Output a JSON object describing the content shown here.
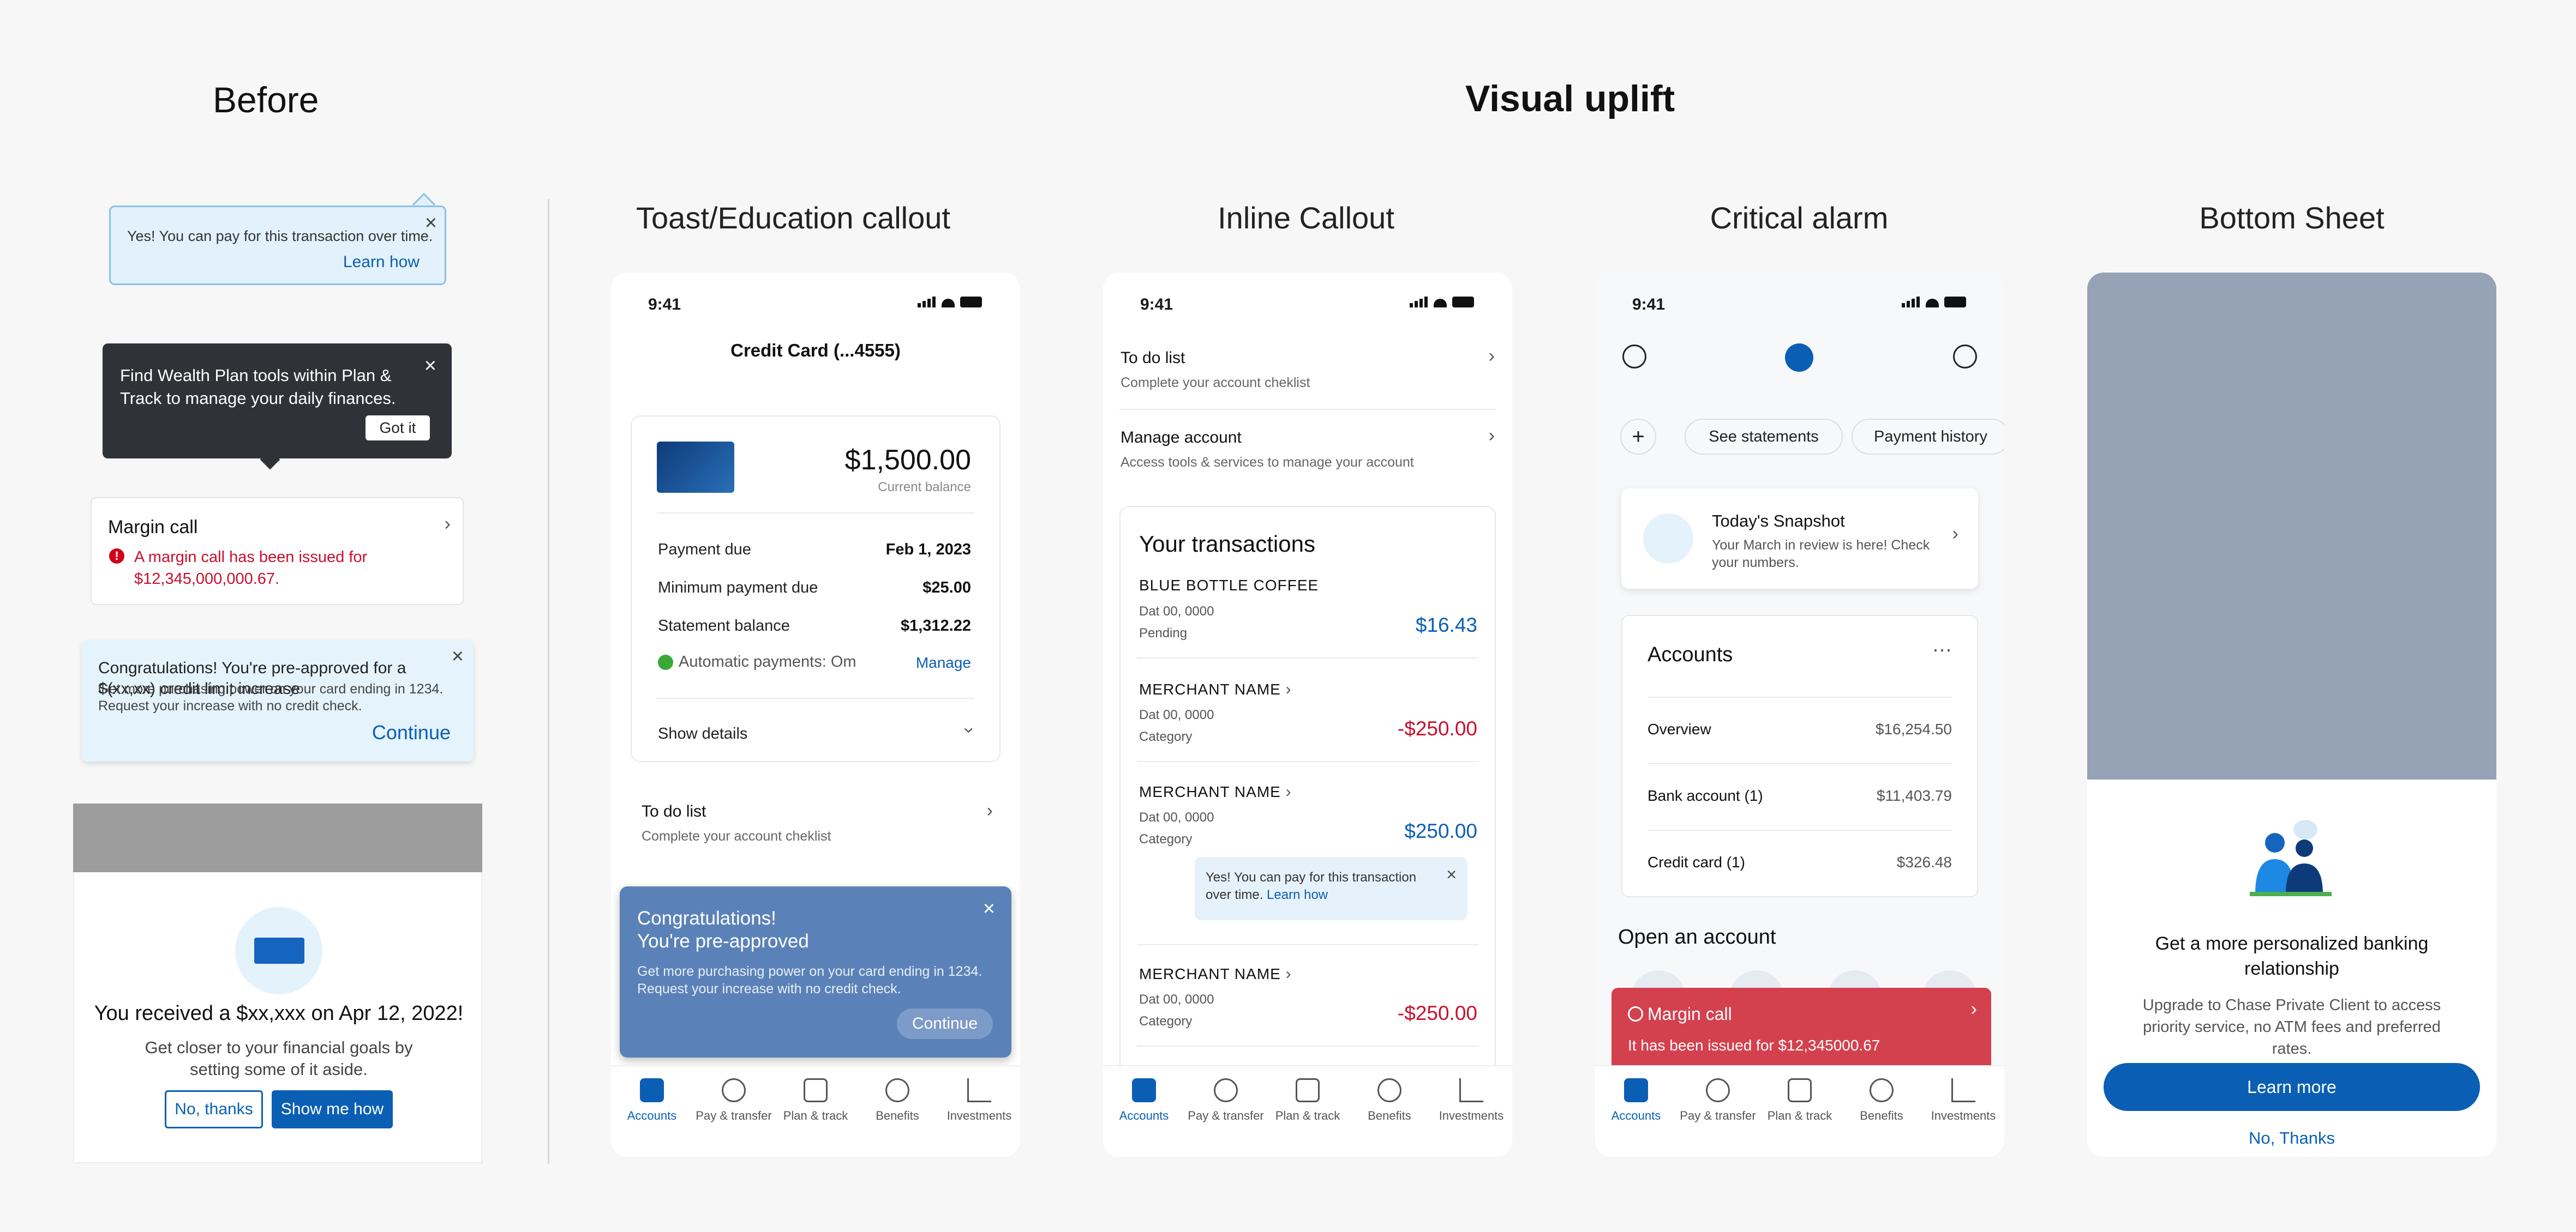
{
  "headings": {
    "before": "Before",
    "uplift": "Visual uplift"
  },
  "columns": [
    "Toast/Education callout",
    "Inline Callout",
    "Critical alarm",
    "Bottom Sheet"
  ],
  "before": {
    "tooltip1": {
      "text": "Yes! You can pay for this transaction over time.",
      "link": "Learn how"
    },
    "tooltip2": {
      "text": "Find Wealth Plan tools within Plan & Track to manage your daily finances.",
      "button": "Got it"
    },
    "margin_card": {
      "title": "Margin call",
      "error": "A margin call has been issued for $12,345,000,000.67."
    },
    "promo": {
      "line1": "Congratulations! You're pre-approved for a $(xx,xx) credit limit increase",
      "line2": "Get more purchasing power on your card ending in 1234. Request your increase with no credit check.",
      "link": "Continue"
    },
    "modal": {
      "title": "You received a $xx,xxx on Apr 12, 2022!",
      "subtitle": "Get closer to your financial goals by setting some of it aside.",
      "btn_secondary": "No, thanks",
      "btn_primary": "Show me how"
    }
  },
  "status_time": "9:41",
  "nav": [
    "Accounts",
    "Pay & transfer",
    "Plan & track",
    "Benefits",
    "Investments"
  ],
  "phone1": {
    "title": "Credit Card (...4555)",
    "balance": "$1,500.00",
    "balance_label": "Current balance",
    "rows": [
      {
        "label": "Payment due",
        "value": "Feb 1, 2023"
      },
      {
        "label": "Minimum payment due",
        "value": "$25.00"
      },
      {
        "label": "Statement balance",
        "value": "$1,312.22"
      }
    ],
    "autopay": "Automatic payments: Om",
    "manage": "Manage",
    "show_details": "Show details",
    "todo_title": "To do list",
    "todo_sub": "Complete your account cheklist",
    "toast": {
      "title1": "Congratulations!",
      "title2": "You're pre-approved",
      "body": "Get more purchasing power on your card ending in 1234. Request your increase with no credit check.",
      "button": "Continue"
    }
  },
  "phone2": {
    "todo_title": "To do list",
    "todo_sub": "Complete your account cheklist",
    "manage_title": "Manage account",
    "manage_sub": "Access tools & services to manage your account",
    "tx_heading": "Your transactions",
    "transactions": [
      {
        "name": "BLUE BOTTLE COFFEE",
        "date": "Dat 00, 0000",
        "meta": "Pending",
        "amount": "$16.43"
      },
      {
        "name": "MERCHANT  NAME",
        "date": "Dat 00, 0000",
        "meta": "Category",
        "amount": "-$250.00"
      },
      {
        "name": "MERCHANT  NAME",
        "date": "Dat 00, 0000",
        "meta": "Category",
        "amount": "$250.00"
      },
      {
        "name": "MERCHANT  NAME",
        "date": "Dat 00, 0000",
        "meta": "Category",
        "amount": "-$250.00"
      }
    ],
    "callout_text": "Yes! You can pay for this transaction over time.",
    "callout_link": "Learn how"
  },
  "phone3": {
    "pills": [
      "See statements",
      "Payment history"
    ],
    "snapshot_title": "Today's Snapshot",
    "snapshot_sub": "Your March in review is here! Check your numbers.",
    "accounts_heading": "Accounts",
    "accounts": [
      {
        "label": "Overview",
        "value": "$16,254.50"
      },
      {
        "label": "Bank account (1)",
        "value": "$11,403.79"
      },
      {
        "label": "Credit card (1)",
        "value": "$326.48"
      }
    ],
    "open_heading": "Open an account",
    "alarm_title": "Margin call",
    "alarm_sub": "It has been issued for $12,345000.67"
  },
  "phone4": {
    "sheet_title": "Get a more personalized banking relationship",
    "sheet_sub": "Upgrade to Chase Private Client to access priority service, no ATM fees and preferred rates.",
    "sheet_button": "Learn more",
    "sheet_link": "No, Thanks"
  },
  "colors": {
    "brand_blue": "#0a5fb4",
    "error_red": "#c8102e",
    "alarm_red": "#d4414e"
  }
}
